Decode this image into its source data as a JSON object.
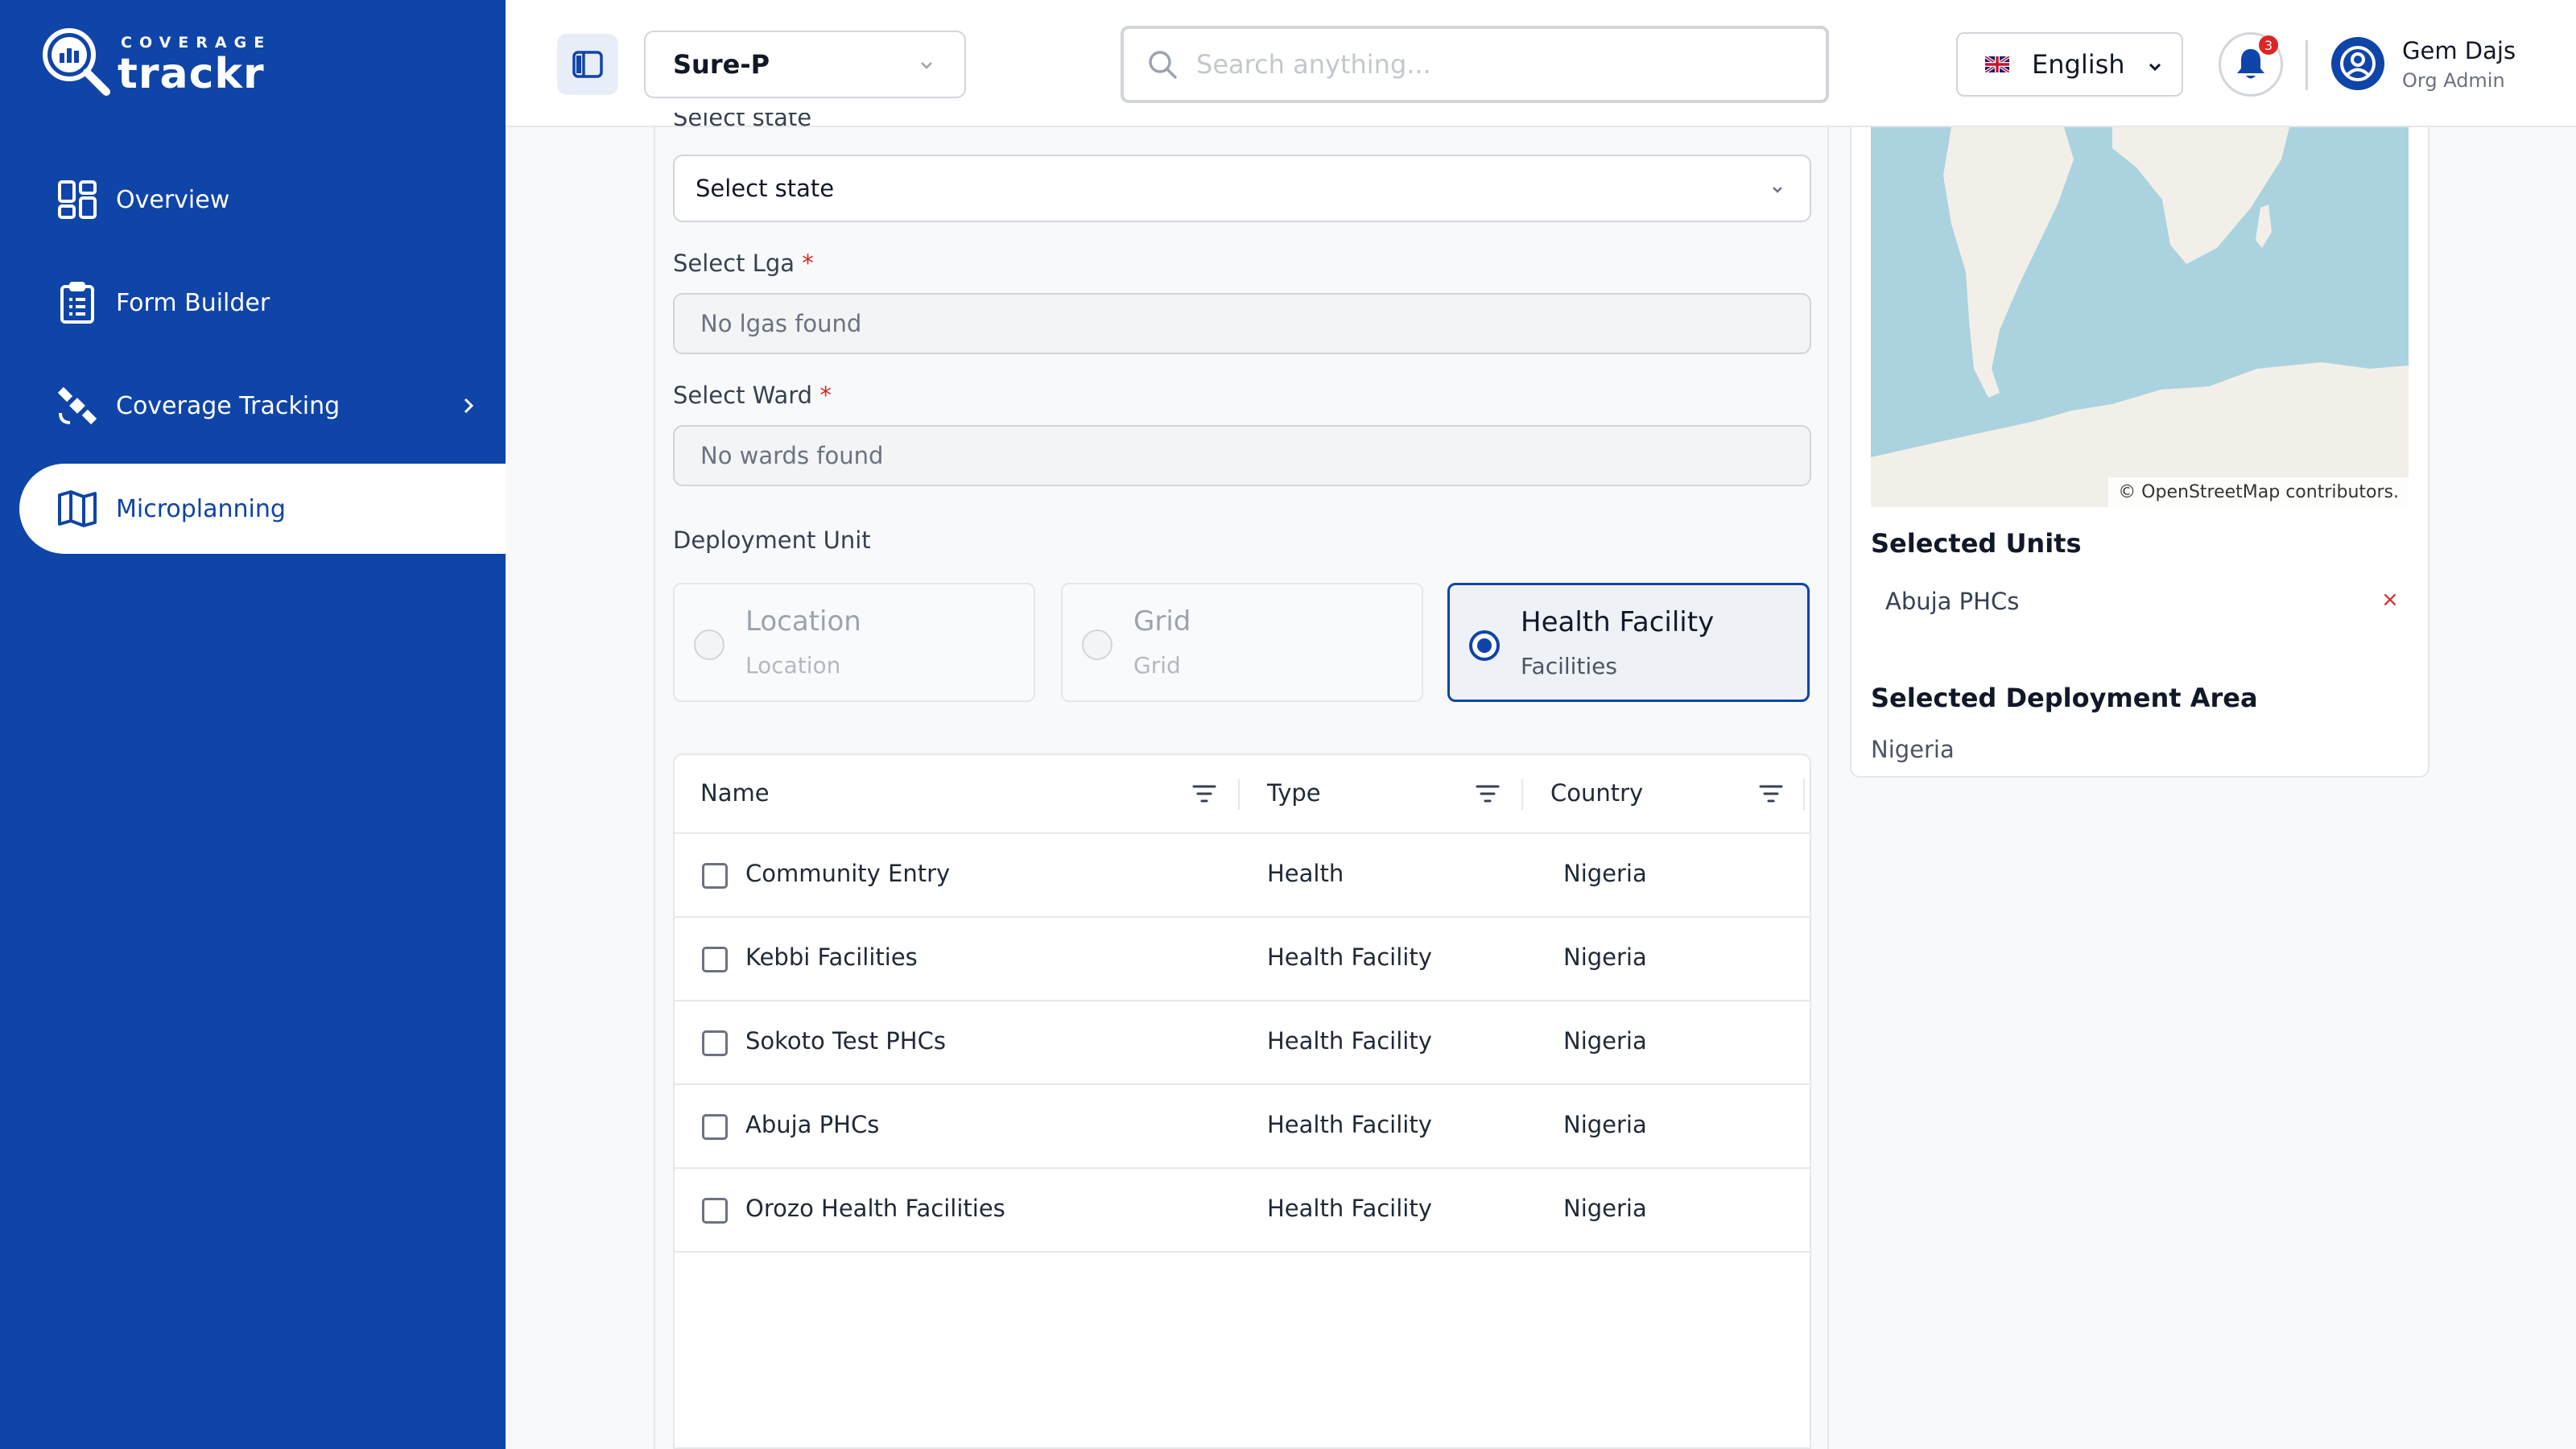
{
  "brand": {
    "small": "COVERAGE",
    "big": "trackr"
  },
  "sidebar": {
    "items": [
      {
        "label": "Overview",
        "icon": "dashboard-grid-icon"
      },
      {
        "label": "Form Builder",
        "icon": "clipboard-list-icon"
      },
      {
        "label": "Coverage Tracking",
        "icon": "satellite-icon"
      },
      {
        "label": "Microplanning",
        "icon": "map-icon",
        "active": true
      }
    ]
  },
  "header": {
    "org": "Sure-P",
    "search_placeholder": "Search anything...",
    "language": "English",
    "notifications": "3",
    "user_name": "Gem Dajs",
    "user_role": "Org Admin"
  },
  "form": {
    "state_label": "Select state",
    "state_value": "Select state",
    "lga_label": "Select Lga",
    "lga_value": "No lgas found",
    "ward_label": "Select Ward",
    "ward_value": "No wards found",
    "required_mark": "*",
    "deployment_label": "Deployment Unit",
    "units": [
      {
        "title": "Location",
        "subtitle": "Location"
      },
      {
        "title": "Grid",
        "subtitle": "Grid"
      },
      {
        "title": "Health Facility",
        "subtitle": "Facilities",
        "selected": true
      }
    ]
  },
  "table": {
    "headers": [
      "Name",
      "Type",
      "Country"
    ],
    "rows": [
      {
        "name": "Community Entry",
        "type": "Health",
        "country": "Nigeria"
      },
      {
        "name": "Kebbi Facilities",
        "type": "Health Facility",
        "country": "Nigeria"
      },
      {
        "name": "Sokoto Test PHCs",
        "type": "Health Facility",
        "country": "Nigeria"
      },
      {
        "name": "Abuja PHCs",
        "type": "Health Facility",
        "country": "Nigeria"
      },
      {
        "name": "Orozo Health Facilities",
        "type": "Health Facility",
        "country": "Nigeria"
      }
    ]
  },
  "panel": {
    "map_attribution": "© OpenStreetMap contributors.",
    "selected_units_title": "Selected Units",
    "selected_unit": "Abuja PHCs",
    "remove_glyph": "×",
    "deployment_area_title": "Selected Deployment Area",
    "deployment_area": "Nigeria"
  },
  "colors": {
    "brand": "#0f44a8",
    "danger": "#dc2626",
    "water": "#aad3df",
    "land": "#f2efe9"
  }
}
